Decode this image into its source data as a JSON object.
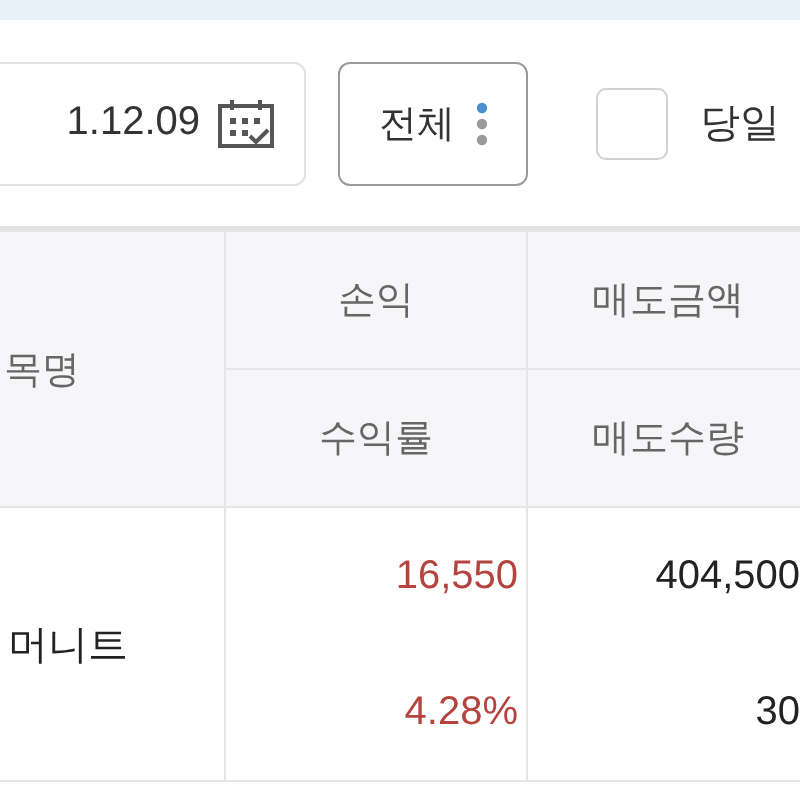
{
  "toolbar": {
    "date_field": {
      "value": "1.12.09"
    },
    "filter_dropdown": {
      "label": "전체"
    },
    "same_day_checkbox": {
      "label": "당일",
      "checked": false
    }
  },
  "table": {
    "header": {
      "column_1": "목명",
      "row_1": [
        "손익",
        "매도금액"
      ],
      "row_2": [
        "수익률",
        "매도수량"
      ]
    },
    "rows": [
      {
        "name": "머니트",
        "profit": "16,550",
        "sell_amount": "404,500",
        "profit_rate": "4.28%",
        "sell_quantity": "30",
        "positive": true
      }
    ]
  }
}
